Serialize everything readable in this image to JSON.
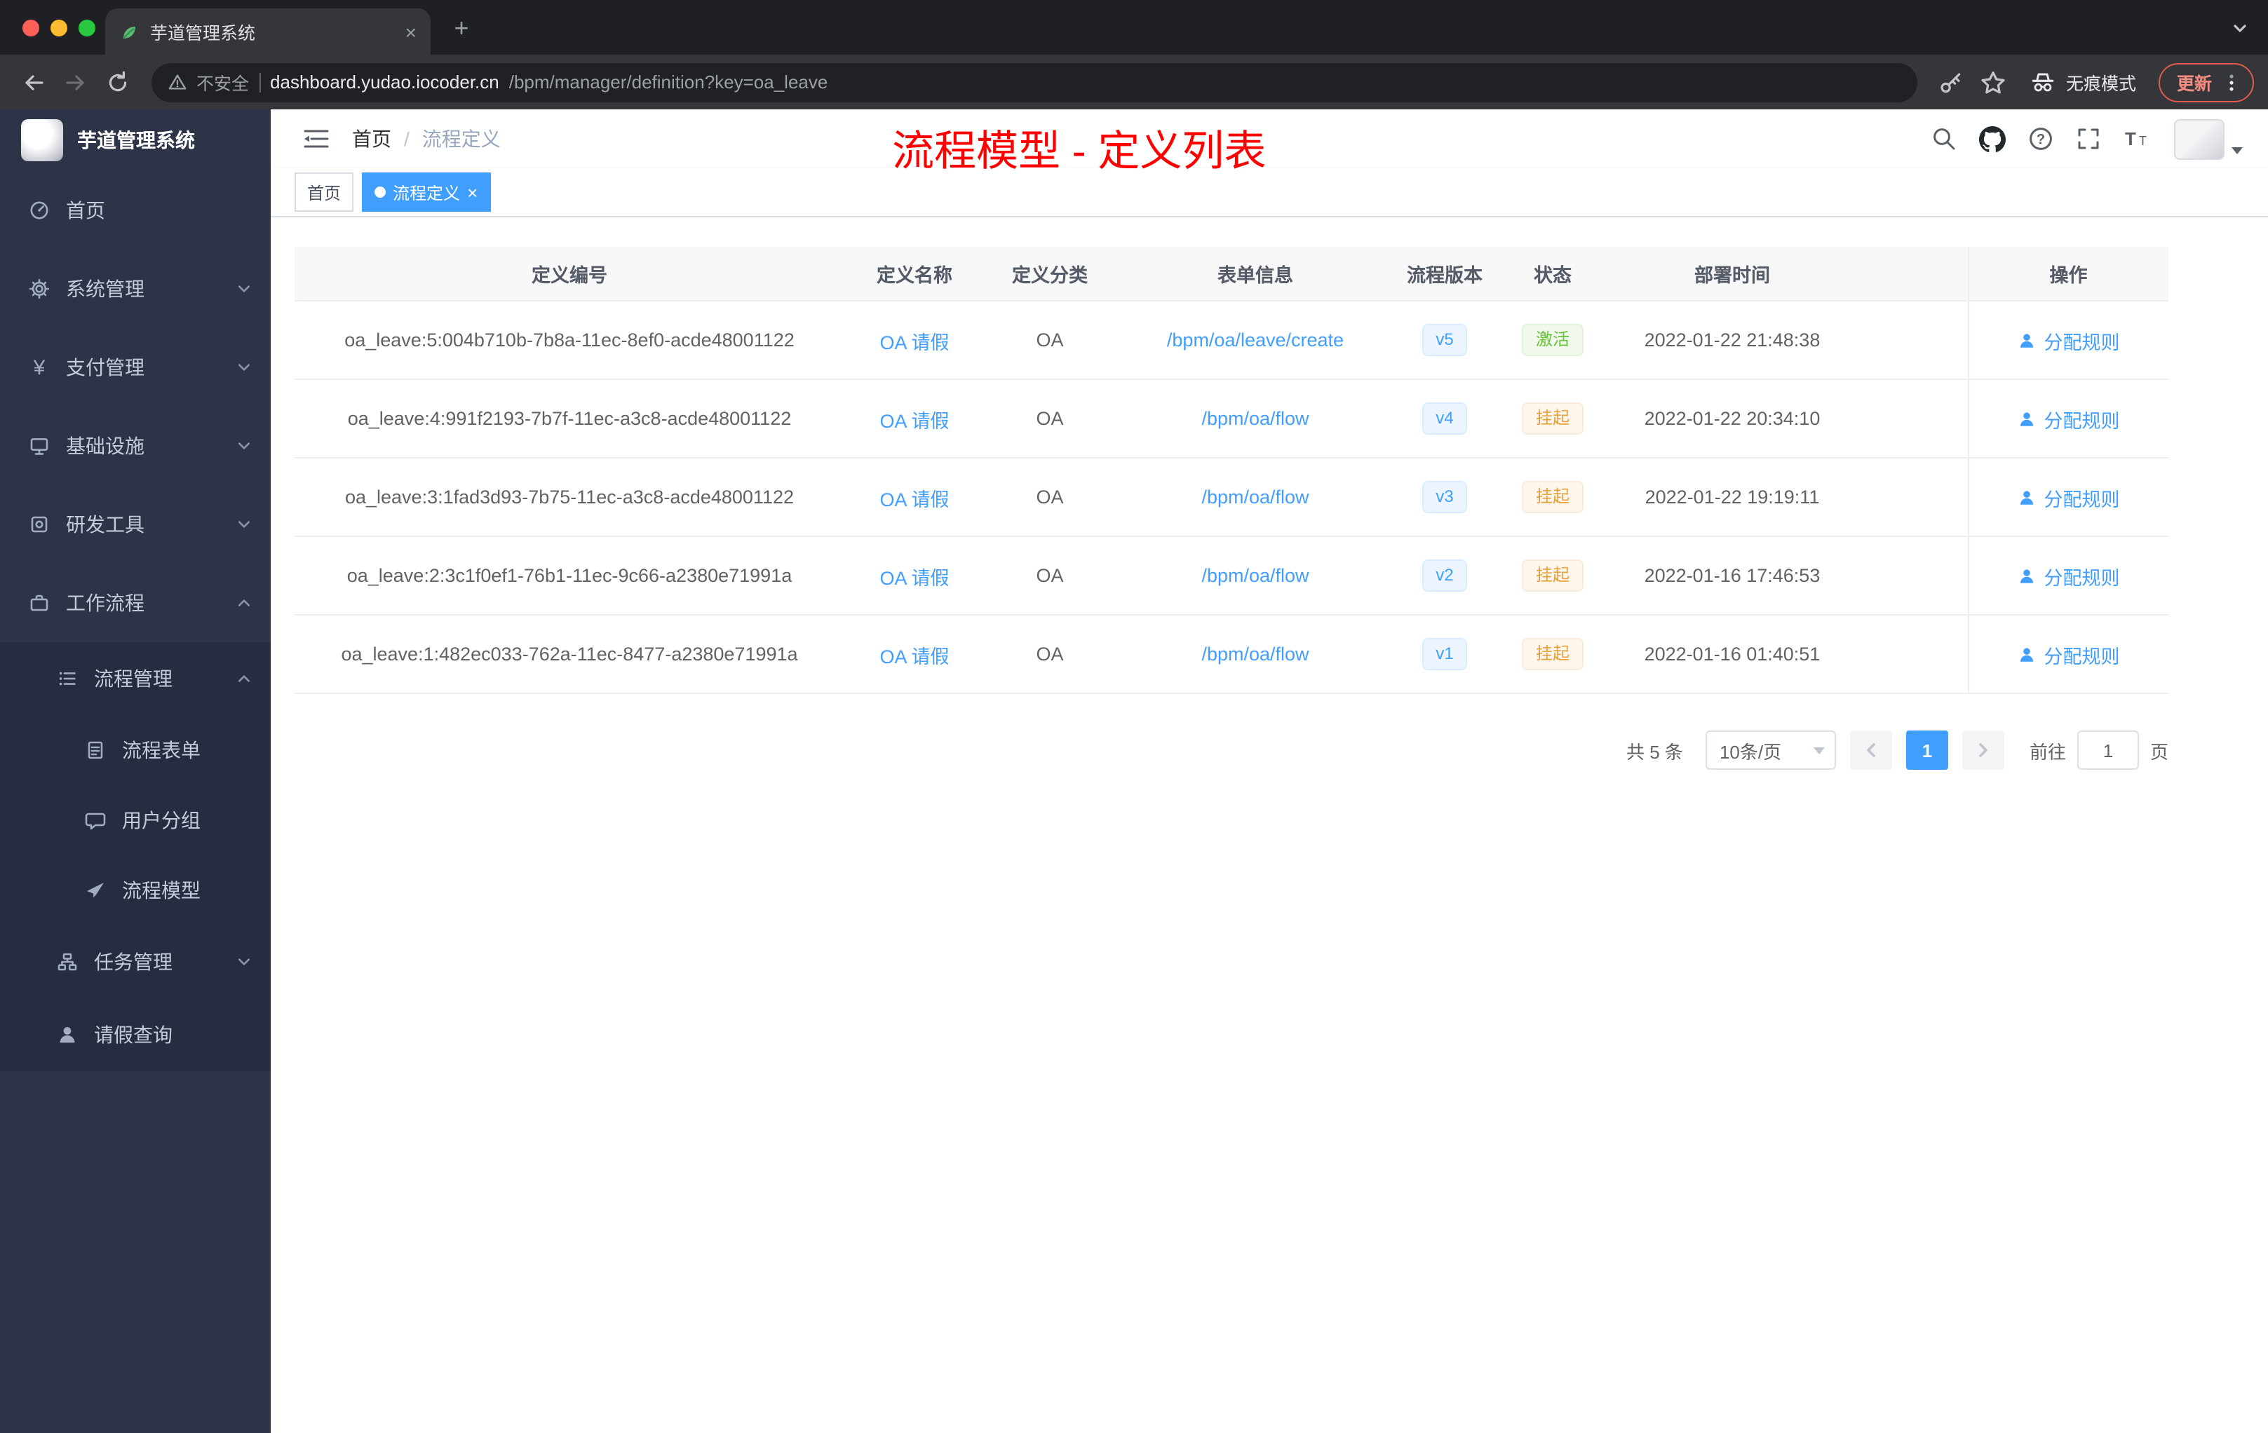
{
  "colors": {
    "accent": "#409eff",
    "success_text": "#67c23a",
    "warning_text": "#e6a23c",
    "annotation_red": "#ff0000",
    "sidebar_bg": "#2e3447",
    "submenu_bg": "#272d40",
    "chrome_dark": "#1f2023",
    "chrome_toolbar": "#35363a"
  },
  "glyphs": {
    "close": "×",
    "plus": "+"
  },
  "browser": {
    "tab": {
      "title": "芋道管理系统"
    },
    "toolbar": {
      "security_label": "不安全",
      "url_domain": "dashboard.yudao.iocoder.cn",
      "url_path": "/bpm/manager/definition?key=oa_leave",
      "incognito_label": "无痕模式",
      "update_label": "更新"
    }
  },
  "sidebar": {
    "logo_title": "芋道管理系统",
    "items": [
      {
        "label": "首页"
      },
      {
        "label": "系统管理"
      },
      {
        "label": "支付管理"
      },
      {
        "label": "基础设施"
      },
      {
        "label": "研发工具"
      },
      {
        "label": "工作流程"
      },
      {
        "label": "流程管理"
      },
      {
        "label": "流程表单"
      },
      {
        "label": "用户分组"
      },
      {
        "label": "流程模型"
      },
      {
        "label": "任务管理"
      },
      {
        "label": "请假查询"
      }
    ]
  },
  "navbar": {
    "breadcrumb": {
      "home": "首页",
      "separator": "/",
      "current": "流程定义"
    },
    "annotation": "流程模型 - 定义列表"
  },
  "tags": {
    "home": "首页",
    "active": "流程定义"
  },
  "table": {
    "columns": [
      "定义编号",
      "定义名称",
      "定义分类",
      "表单信息",
      "流程版本",
      "状态",
      "部署时间",
      "操作"
    ],
    "action_label": "分配规则",
    "rows": [
      {
        "id": "oa_leave:5:004b710b-7b8a-11ec-8ef0-acde48001122",
        "name": "OA 请假",
        "category": "OA",
        "form": "/bpm/oa/leave/create",
        "version": "v5",
        "status": "激活",
        "status_type": "success",
        "time": "2022-01-22 21:48:38"
      },
      {
        "id": "oa_leave:4:991f2193-7b7f-11ec-a3c8-acde48001122",
        "name": "OA 请假",
        "category": "OA",
        "form": "/bpm/oa/flow",
        "version": "v4",
        "status": "挂起",
        "status_type": "warning",
        "time": "2022-01-22 20:34:10"
      },
      {
        "id": "oa_leave:3:1fad3d93-7b75-11ec-a3c8-acde48001122",
        "name": "OA 请假",
        "category": "OA",
        "form": "/bpm/oa/flow",
        "version": "v3",
        "status": "挂起",
        "status_type": "warning",
        "time": "2022-01-22 19:19:11"
      },
      {
        "id": "oa_leave:2:3c1f0ef1-76b1-11ec-9c66-a2380e71991a",
        "name": "OA 请假",
        "category": "OA",
        "form": "/bpm/oa/flow",
        "version": "v2",
        "status": "挂起",
        "status_type": "warning",
        "time": "2022-01-16 17:46:53"
      },
      {
        "id": "oa_leave:1:482ec033-762a-11ec-8477-a2380e71991a",
        "name": "OA 请假",
        "category": "OA",
        "form": "/bpm/oa/flow",
        "version": "v1",
        "status": "挂起",
        "status_type": "warning",
        "time": "2022-01-16 01:40:51"
      }
    ]
  },
  "pagination": {
    "total": "共 5 条",
    "page_size": "10条/页",
    "current_page": "1",
    "goto_label": "前往",
    "goto_value": "1",
    "goto_unit": "页"
  }
}
